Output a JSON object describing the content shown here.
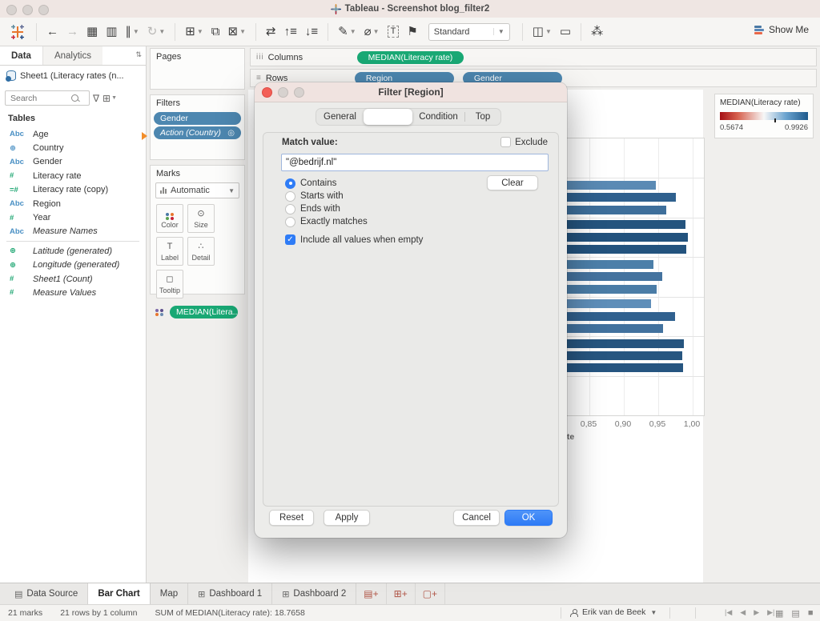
{
  "colors": {
    "pill_blue": "#4d87b0",
    "pill_green": "#19a874",
    "selection_blue": "#2f7cf6",
    "ok_button_blue": "#2e7bf6",
    "legend_red": "#a50f15",
    "legend_dark_blue": "#1f5a8c",
    "bar_dark": "#24547e",
    "bar_medium": "#41729d",
    "bar_light": "#5a8ab4",
    "dialog_titlebar_pink": "#f0e3e0"
  },
  "window": {
    "title": "Tableau - Screenshot blog_filter2"
  },
  "toolbar": {
    "items_left": [
      {
        "name": "undo-icon",
        "glyph": "←"
      },
      {
        "name": "redo-icon",
        "glyph": "→",
        "disabled": true
      },
      {
        "name": "save-icon",
        "glyph": "▦"
      },
      {
        "name": "new-data-source-icon",
        "glyph": "▥"
      },
      {
        "name": "pause-auto-updates-icon",
        "glyph": "∥",
        "caret": true
      },
      {
        "name": "run-auto-updates-icon",
        "glyph": "↻",
        "disabled": true,
        "caret": true
      },
      {
        "name": "new-worksheet-icon",
        "glyph": "⊞",
        "caret": true,
        "sep": true
      },
      {
        "name": "duplicate-icon",
        "glyph": "⧉"
      },
      {
        "name": "clear-sheet-icon",
        "glyph": "⊠",
        "caret": true
      },
      {
        "name": "swap-rows-columns-icon",
        "glyph": "⇄",
        "sep": true
      },
      {
        "name": "sort-ascending-icon",
        "glyph": "↑≡"
      },
      {
        "name": "sort-descending-icon",
        "glyph": "↓≡"
      },
      {
        "name": "highlight-icon",
        "glyph": "✎",
        "caret": true,
        "sep": true
      },
      {
        "name": "format-icon",
        "glyph": "⌀",
        "caret": true
      },
      {
        "name": "text-annotation-icon",
        "glyph": "T",
        "boxed": true
      },
      {
        "name": "pin-icon",
        "glyph": "⚑"
      }
    ],
    "fit_value": "Standard",
    "items_right": [
      {
        "name": "show-mark-labels-icon",
        "glyph": "◫",
        "caret": true,
        "sep": true
      },
      {
        "name": "presentation-mode-icon",
        "glyph": "▭"
      },
      {
        "name": "share-icon",
        "glyph": "⁂",
        "sep": true
      }
    ],
    "show_me_label": "Show Me"
  },
  "data_pane": {
    "tab_data": "Data",
    "tab_analytics": "Analytics",
    "connection": "Sheet1 (Literacy rates (n...",
    "search_placeholder": "Search",
    "tables_label": "Tables",
    "fields": [
      {
        "glyph": "Abc",
        "color": "blue",
        "name": "Age"
      },
      {
        "glyph": "⊕",
        "color": "blue",
        "name": "Country"
      },
      {
        "glyph": "Abc",
        "color": "blue",
        "name": "Gender"
      },
      {
        "glyph": "#",
        "color": "green",
        "name": "Literacy rate"
      },
      {
        "glyph": "=#",
        "color": "green",
        "name": "Literacy rate (copy)"
      },
      {
        "glyph": "Abc",
        "color": "blue",
        "name": "Region"
      },
      {
        "glyph": "#",
        "color": "green",
        "name": "Year"
      },
      {
        "glyph": "Abc",
        "color": "blue",
        "name": "Measure Names",
        "italic": true
      },
      {
        "divider": true
      },
      {
        "glyph": "⊕",
        "color": "green",
        "name": "Latitude (generated)",
        "italic": true
      },
      {
        "glyph": "⊕",
        "color": "green",
        "name": "Longitude (generated)",
        "italic": true
      },
      {
        "glyph": "#",
        "color": "green",
        "name": "Sheet1 (Count)",
        "italic": true
      },
      {
        "glyph": "#",
        "color": "green",
        "name": "Measure Values",
        "italic": true
      }
    ]
  },
  "cards": {
    "pages_label": "Pages",
    "filters_label": "Filters",
    "filter_pills": [
      {
        "label": "Gender"
      },
      {
        "label": "Action (Country)",
        "italic": true,
        "icon": "◎"
      }
    ],
    "marks_label": "Marks",
    "marks_type": "Automatic",
    "marks_buttons": [
      {
        "name": "color-button",
        "label": "Color",
        "icon": "dots"
      },
      {
        "name": "size-button",
        "label": "Size",
        "glyph": "⊙"
      },
      {
        "name": "label-button",
        "label": "Label",
        "glyph": "T"
      },
      {
        "name": "detail-button",
        "label": "Detail",
        "glyph": "∴"
      },
      {
        "name": "tooltip-button",
        "label": "Tooltip",
        "glyph": "◻"
      }
    ],
    "marks_pill": "MEDIAN(Litera.."
  },
  "shelves": {
    "columns_label": "Columns",
    "rows_label": "Rows",
    "columns_pills": [
      {
        "label": "MEDIAN(Literacy rate)",
        "type": "measure"
      }
    ],
    "rows_pills": [
      {
        "label": "Region",
        "type": "dimension"
      },
      {
        "label": "Gender",
        "type": "dimension"
      }
    ]
  },
  "dialog": {
    "title": "Filter [Region]",
    "tabs": [
      "General",
      "",
      "Condition",
      "Top"
    ],
    "selected_tab_index": 1,
    "match_label": "Match value:",
    "exclude_label": "Exclude",
    "match_value": "\"@bedrijf.nl\"",
    "radios": [
      "Contains",
      "Starts with",
      "Ends with",
      "Exactly matches"
    ],
    "selected_radio_index": 0,
    "clear_label": "Clear",
    "include_label": "Include all values when empty",
    "include_checked": true,
    "reset_label": "Reset",
    "apply_label": "Apply",
    "cancel_label": "Cancel",
    "ok_label": "OK"
  },
  "legend": {
    "title": "MEDIAN(Literacy rate)",
    "min": "0.5674",
    "max": "0.9926"
  },
  "chart_data": {
    "type": "bar",
    "orientation": "horizontal",
    "title": "",
    "xlabel_visible_fragment": "ate",
    "x_axis": {
      "tick_labels": [
        "0,85",
        "0,90",
        "0,95",
        "1,00"
      ],
      "tick_values": [
        0.85,
        0.9,
        0.95,
        1.0
      ]
    },
    "row_structure": "Region x Gender, 7 region groups of 3 bars; first and last group bars end left of visible area",
    "groups": [
      {
        "bars": []
      },
      {
        "bars": [
          {
            "value": 0.947,
            "color": "#5a8ab4"
          },
          {
            "value": 0.975,
            "color": "#2f608e"
          },
          {
            "value": 0.962,
            "color": "#3e6f9b"
          }
        ]
      },
      {
        "bars": [
          {
            "value": 0.99,
            "color": "#24547e"
          },
          {
            "value": 0.993,
            "color": "#22527d"
          },
          {
            "value": 0.991,
            "color": "#23537e"
          }
        ]
      },
      {
        "bars": [
          {
            "value": 0.943,
            "color": "#4c7fa9"
          },
          {
            "value": 0.956,
            "color": "#44739f"
          },
          {
            "value": 0.948,
            "color": "#4a7ca6"
          }
        ]
      },
      {
        "bars": [
          {
            "value": 0.939,
            "color": "#5e8eb9"
          },
          {
            "value": 0.974,
            "color": "#30618f"
          },
          {
            "value": 0.957,
            "color": "#42729e"
          }
        ]
      },
      {
        "bars": [
          {
            "value": 0.987,
            "color": "#26557f"
          },
          {
            "value": 0.985,
            "color": "#275680"
          },
          {
            "value": 0.986,
            "color": "#265580"
          }
        ]
      },
      {
        "bars": []
      }
    ],
    "legend": {
      "title": "MEDIAN(Literacy rate)",
      "min": 0.5674,
      "max": 0.9926,
      "palette": "red-white-blue diverging"
    }
  },
  "sheet_tabs": {
    "tabs": [
      {
        "label": "Data Source",
        "icon": "database-icon",
        "glyph": "▤"
      },
      {
        "label": "Bar Chart",
        "active": true
      },
      {
        "label": "Map"
      },
      {
        "label": "Dashboard 1",
        "icon": "dashboard-icon",
        "glyph": "⊞"
      },
      {
        "label": "Dashboard 2",
        "icon": "dashboard-icon",
        "glyph": "⊞"
      }
    ],
    "new_buttons": [
      {
        "name": "new-worksheet-tab-button",
        "glyph": "▤+"
      },
      {
        "name": "new-dashboard-tab-button",
        "glyph": "⊞+"
      },
      {
        "name": "new-story-tab-button",
        "glyph": "▢+"
      }
    ]
  },
  "status_bar": {
    "marks": "21 marks",
    "dimensions": "21 rows by 1 column",
    "aggregate": "SUM of MEDIAN(Literacy rate): 18.7658",
    "user": "Erik van de Beek",
    "nav_icons": [
      "|◀",
      "◀",
      "▶",
      "▶|"
    ],
    "view_icons": [
      "▦",
      "▤",
      "■"
    ]
  }
}
